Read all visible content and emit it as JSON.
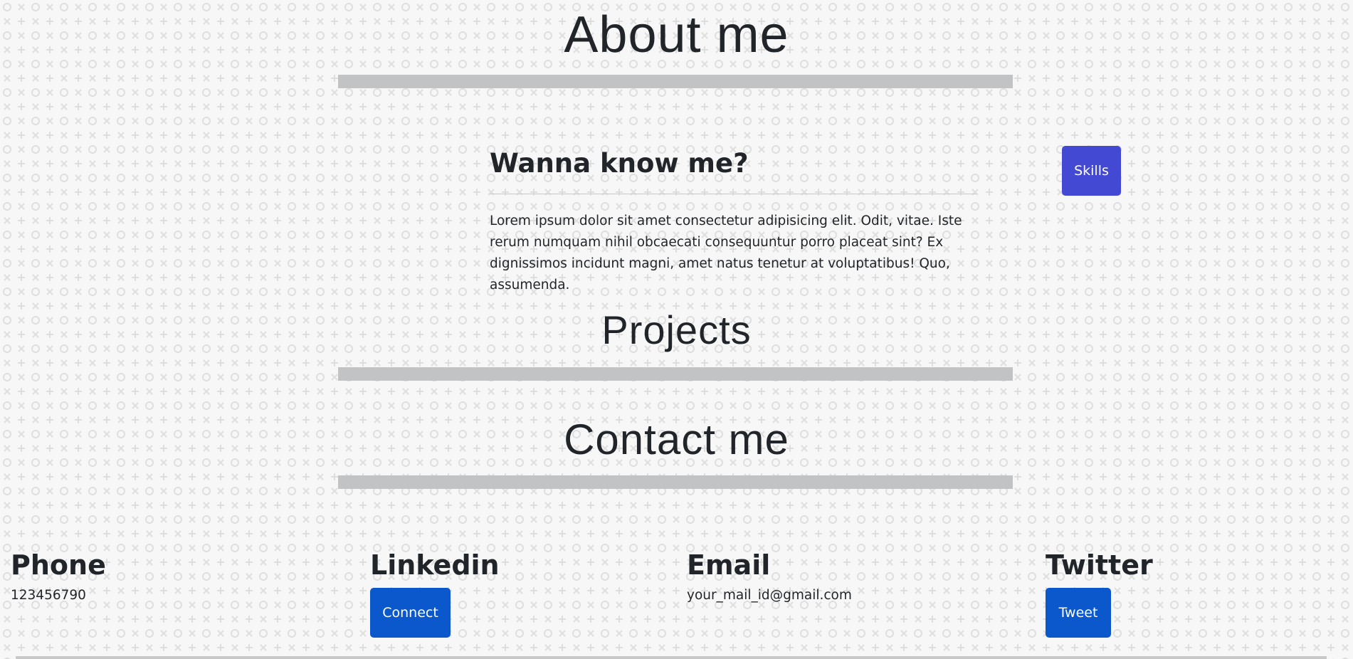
{
  "about": {
    "title": "About me",
    "heading": "Wanna know me?",
    "text": "Lorem ipsum dolor sit amet consectetur adipisicing elit. Odit, vitae. Iste rerum numquam nihil obcaecati consequuntur porro placeat sint? Ex dignissimos incidunt magni, amet natus tenetur at voluptatibus! Quo, assumenda.",
    "skills_button": "Skills"
  },
  "projects": {
    "title": "Projects"
  },
  "contact": {
    "title": "Contact me",
    "phone": {
      "heading": "Phone",
      "value": "123456790"
    },
    "linkedin": {
      "heading": "Linkedin",
      "button": "Connect"
    },
    "email": {
      "heading": "Email",
      "value": "your_mail_id@gmail.com"
    },
    "twitter": {
      "heading": "Twitter",
      "button": "Tweet"
    }
  },
  "colors": {
    "skills_button": "#4349d3",
    "primary_button": "#0b57cc",
    "title_bar": "#c2c3c5"
  }
}
